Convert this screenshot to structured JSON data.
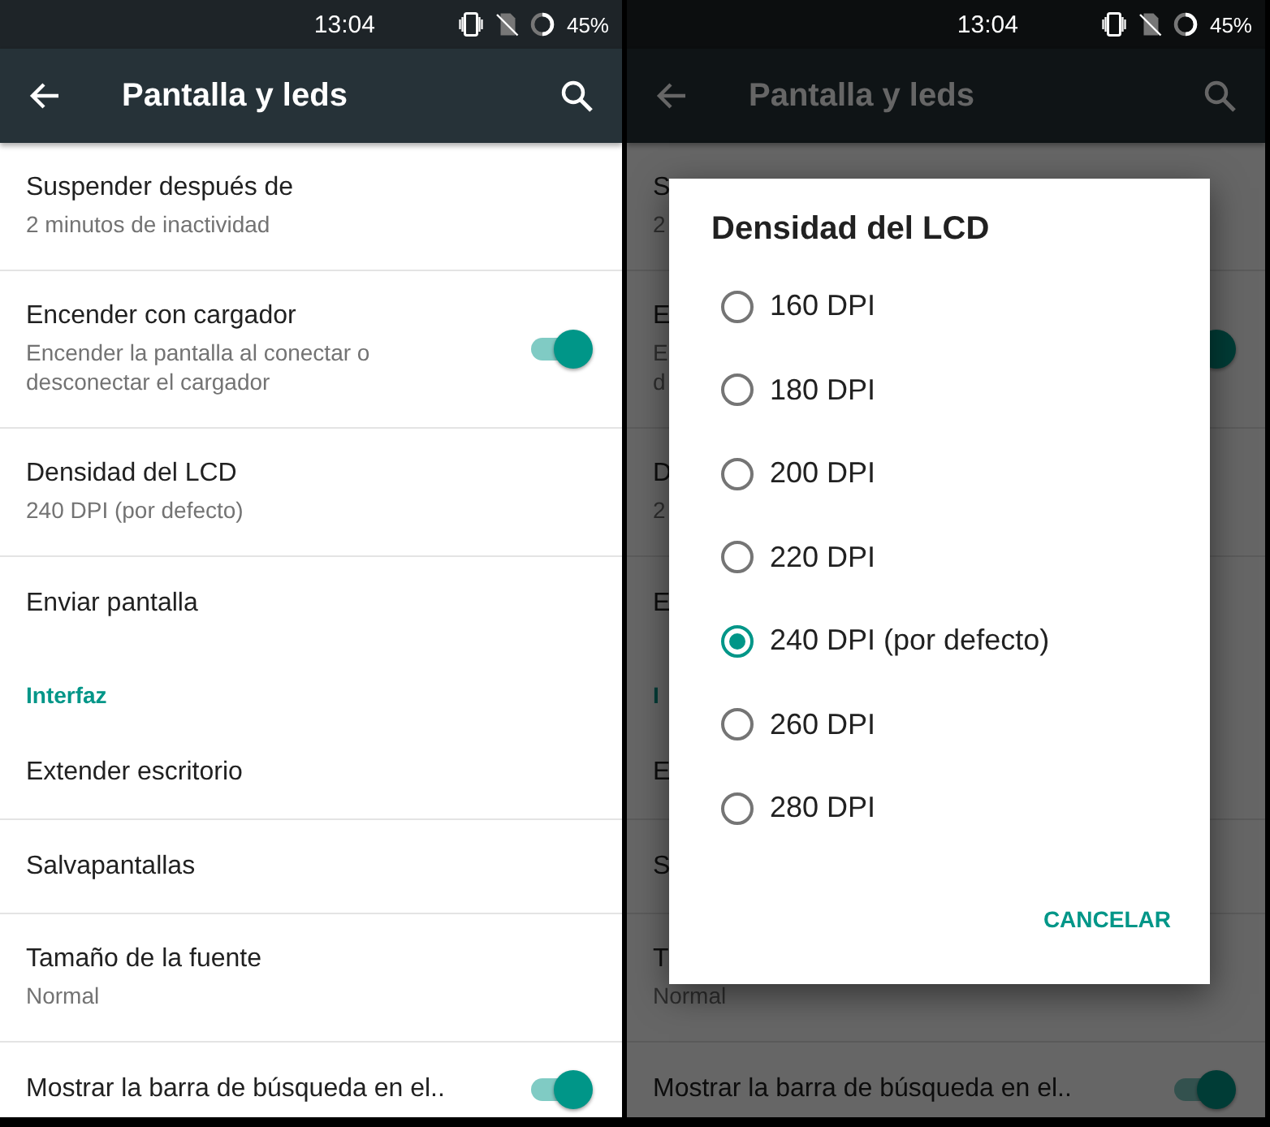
{
  "left_screen": {
    "status_bar": {
      "time": "13:04",
      "battery": "45%"
    },
    "toolbar": {
      "title": "Pantalla y leds"
    },
    "settings": [
      {
        "kind": "item",
        "title": "Suspender después de",
        "subtitle": [
          "2 minutos de inactividad"
        ]
      },
      {
        "kind": "item",
        "title": "Encender con cargador",
        "subtitle": [
          "Encender la pantalla al conectar o",
          "desconectar el cargador"
        ],
        "switch_on": true
      },
      {
        "kind": "item",
        "title": "Densidad del LCD",
        "subtitle": [
          "240 DPI (por defecto)"
        ]
      },
      {
        "kind": "item",
        "title": "Enviar pantalla"
      },
      {
        "kind": "category",
        "title": "Interfaz"
      },
      {
        "kind": "item",
        "title": "Extender escritorio"
      },
      {
        "kind": "item",
        "title": "Salvapantallas"
      },
      {
        "kind": "item",
        "title": "Tamaño de la fuente",
        "subtitle": [
          "Normal"
        ]
      },
      {
        "kind": "item",
        "title": "Mostrar la barra de búsqueda en el..",
        "switch_on": true
      }
    ]
  },
  "right_screen": {
    "status_bar": {
      "time": "13:04",
      "battery": "45%"
    },
    "toolbar": {
      "title": "Pantalla y leds"
    },
    "settings": [
      {
        "kind": "item",
        "title": "S",
        "subtitle": [
          "2"
        ]
      },
      {
        "kind": "item",
        "title": "E",
        "subtitle": [
          "E",
          "d"
        ],
        "switch_on": true
      },
      {
        "kind": "item",
        "title": "D",
        "subtitle": [
          "2"
        ]
      },
      {
        "kind": "item",
        "title": "E"
      },
      {
        "kind": "category",
        "title": "I"
      },
      {
        "kind": "item",
        "title": "E"
      },
      {
        "kind": "item",
        "title": "S"
      },
      {
        "kind": "item",
        "title": "T",
        "subtitle": [
          "Normal"
        ]
      },
      {
        "kind": "item",
        "title": "Mostrar la barra de búsqueda en el..",
        "switch_on": true
      }
    ],
    "dialog": {
      "title": "Densidad del LCD",
      "options": [
        {
          "label": "160 DPI",
          "selected": false
        },
        {
          "label": "180 DPI",
          "selected": false
        },
        {
          "label": "200 DPI",
          "selected": false
        },
        {
          "label": "220 DPI",
          "selected": false
        },
        {
          "label": "240 DPI (por defecto)",
          "selected": true
        },
        {
          "label": "260 DPI",
          "selected": false
        },
        {
          "label": "280 DPI",
          "selected": false
        }
      ],
      "buttons": [
        "CANCELAR"
      ]
    }
  }
}
